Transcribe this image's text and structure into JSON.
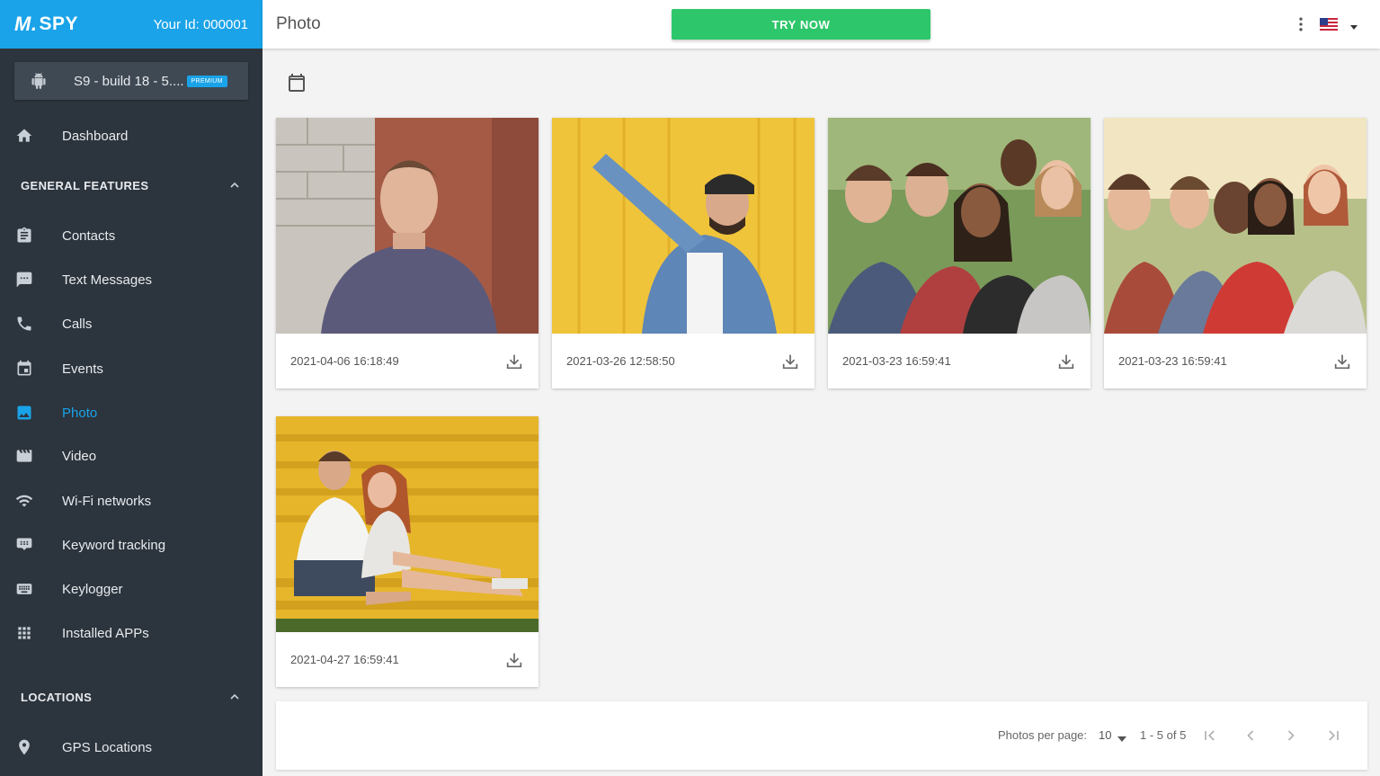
{
  "brand": {
    "logo": "SPY",
    "logo_prefix": "M.",
    "user_id_label": "Your Id: 000001"
  },
  "device": {
    "name": "S9 - build 18 - 5....",
    "badge": "PREMIUM"
  },
  "sidebar": {
    "items": [
      {
        "label": "Dashboard",
        "icon": "home-icon"
      },
      {
        "label": "Contacts",
        "icon": "clipboard-icon"
      },
      {
        "label": "Text Messages",
        "icon": "message-icon"
      },
      {
        "label": "Calls",
        "icon": "phone-icon"
      },
      {
        "label": "Events",
        "icon": "calendar-list-icon"
      },
      {
        "label": "Photo",
        "icon": "image-icon",
        "active": true
      },
      {
        "label": "Video",
        "icon": "film-icon"
      },
      {
        "label": "Wi-Fi networks",
        "icon": "wifi-icon"
      },
      {
        "label": "Keyword tracking",
        "icon": "keyboard-chat-icon"
      },
      {
        "label": "Keylogger",
        "icon": "keyboard-icon"
      },
      {
        "label": "Installed APPs",
        "icon": "apps-grid-icon"
      },
      {
        "label": "GPS Locations",
        "icon": "location-pin-icon"
      }
    ],
    "sections": [
      {
        "label": "GENERAL FEATURES"
      },
      {
        "label": "LOCATIONS"
      }
    ]
  },
  "header": {
    "title": "Photo",
    "try_now": "TRY NOW"
  },
  "photos": [
    {
      "date": "2021-04-06 16:18:49"
    },
    {
      "date": "2021-03-26 12:58:50"
    },
    {
      "date": "2021-03-23 16:59:41"
    },
    {
      "date": "2021-03-23 16:59:41"
    },
    {
      "date": "2021-04-27 16:59:41"
    }
  ],
  "pagination": {
    "per_page_label": "Photos per page:",
    "per_page_value": "10",
    "range": "1 - 5 of 5"
  },
  "colors": {
    "accent": "#1aa3e8",
    "sidebar": "#2c343d",
    "try_button": "#2ec66b"
  }
}
